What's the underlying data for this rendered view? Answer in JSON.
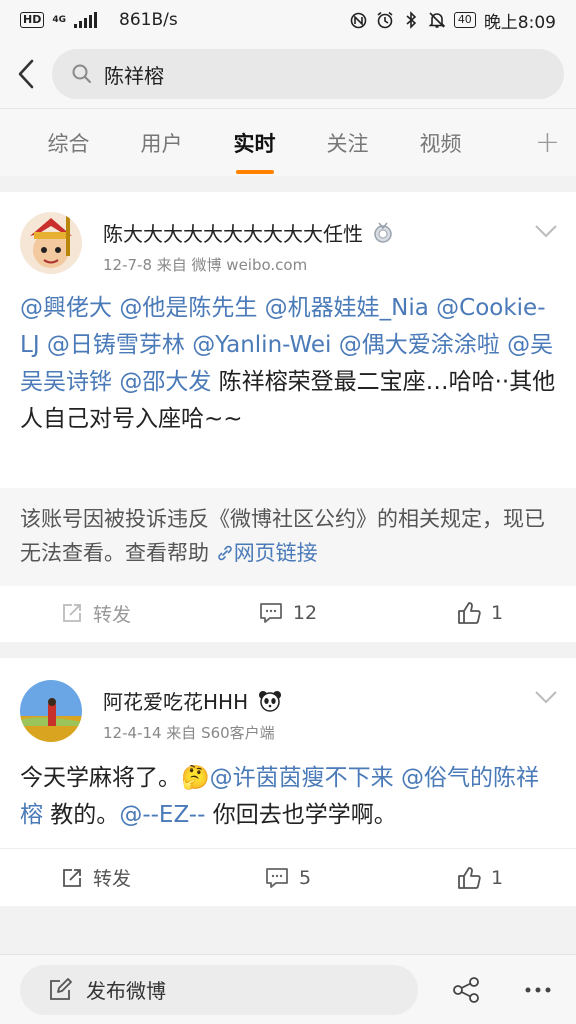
{
  "status_bar": {
    "hd": "HD",
    "network": "4G",
    "speed": "861B/s",
    "battery": "40",
    "time": "晚上8:09"
  },
  "search": {
    "query": "陈祥榕"
  },
  "tabs": [
    {
      "label": "综合",
      "active": false
    },
    {
      "label": "用户",
      "active": false
    },
    {
      "label": "实时",
      "active": true
    },
    {
      "label": "关注",
      "active": false
    },
    {
      "label": "视频",
      "active": false
    }
  ],
  "tabs_plus": "+",
  "posts": [
    {
      "username": "陈大大大大大大大大大大任性",
      "meta": "12-7-8   来自 微博 weibo.com",
      "text_runs": [
        {
          "t": "@興佬大",
          "m": true
        },
        {
          "t": " ",
          "m": false
        },
        {
          "t": "@他是陈先生",
          "m": true
        },
        {
          "t": " ",
          "m": false
        },
        {
          "t": "@机器娃娃_Nia",
          "m": true
        },
        {
          "t": " ",
          "m": false
        },
        {
          "t": "@Cookie-LJ",
          "m": true
        },
        {
          "t": " ",
          "m": false
        },
        {
          "t": "@日铸雪芽林",
          "m": true
        },
        {
          "t": " ",
          "m": false
        },
        {
          "t": "@Yanlin-Wei",
          "m": true
        },
        {
          "t": " ",
          "m": false
        },
        {
          "t": "@偶大爱涂涂啦",
          "m": true
        },
        {
          "t": " ",
          "m": false
        },
        {
          "t": "@吴吴吴诗铧",
          "m": true
        },
        {
          "t": " ",
          "m": false
        },
        {
          "t": "@邵大发",
          "m": true
        },
        {
          "t": " 陈祥榕荣登最二宝座…哈哈··其他人自己对号入座哈~~",
          "m": false
        }
      ],
      "notice": "该账号因被投诉违反《微博社区公约》的相关规定，现已无法查看。查看帮助",
      "notice_link": "网页链接",
      "repost": "转发",
      "comments": "12",
      "likes": "1"
    },
    {
      "username": "阿花爱吃花HHH",
      "meta": "12-4-14   来自 S60客户端",
      "text_runs": [
        {
          "t": "今天学麻将了。",
          "m": false
        },
        {
          "t": "🤔",
          "m": false
        },
        {
          "t": "@许茵茵瘦不下来",
          "m": true
        },
        {
          "t": " ",
          "m": false
        },
        {
          "t": "@俗气的陈祥榕",
          "m": true
        },
        {
          "t": " 教的。",
          "m": false
        },
        {
          "t": "@--EZ--",
          "m": true
        },
        {
          "t": " 你回去也学学啊。",
          "m": false
        }
      ],
      "repost": "转发",
      "comments": "5",
      "likes": "1"
    }
  ],
  "bottom": {
    "compose_label": "发布微博"
  },
  "colors": {
    "accent": "#ff8200",
    "mention": "#4a7ab8"
  }
}
